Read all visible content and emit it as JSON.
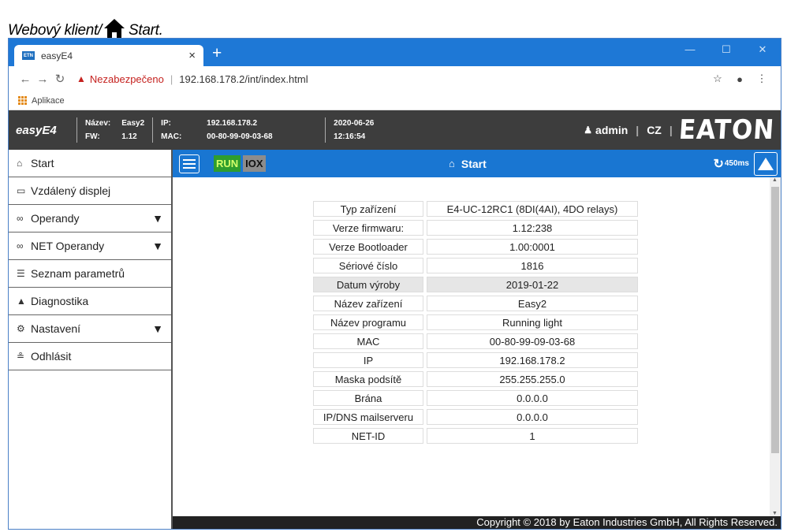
{
  "caption": {
    "prefix": "Webový klient/",
    "suffix": " Start."
  },
  "browser": {
    "tab_favicon": "ETN",
    "tab_title": "easyE4",
    "tab_close": "×",
    "new_tab": "+",
    "security_label": "Nezabezpečeno",
    "url": "192.168.178.2/int/index.html",
    "bookmarks_label": "Aplikace"
  },
  "header": {
    "brand": "easyE4",
    "name_label": "Název:",
    "name_value": "Easy2",
    "fw_label": "FW:",
    "fw_value": "1.12",
    "ip_label": "IP:",
    "ip_value": "192.168.178.2",
    "mac_label": "MAC:",
    "mac_value": "00-80-99-09-03-68",
    "date": "2020-06-26",
    "time": "12:16:54",
    "user": "admin",
    "lang": "CZ",
    "logo": "EATON"
  },
  "sidebar": {
    "items": [
      {
        "label": "Start",
        "icon": "home-icon",
        "glyph": "⌂",
        "caret": false
      },
      {
        "label": "Vzdálený displej",
        "icon": "monitor-icon",
        "glyph": "▭",
        "caret": false
      },
      {
        "label": "Operandy",
        "icon": "link-icon",
        "glyph": "∞",
        "caret": true
      },
      {
        "label": "NET Operandy",
        "icon": "link-icon",
        "glyph": "∞",
        "caret": true
      },
      {
        "label": "Seznam parametrů",
        "icon": "list-icon",
        "glyph": "☰",
        "caret": false
      },
      {
        "label": "Diagnostika",
        "icon": "warning-icon",
        "glyph": "▲",
        "caret": false
      },
      {
        "label": "Nastavení",
        "icon": "gear-icon",
        "glyph": "⚙",
        "caret": true
      },
      {
        "label": "Odhlásit",
        "icon": "user-icon",
        "glyph": "≗",
        "caret": false
      }
    ]
  },
  "toolbar": {
    "run": "RUN",
    "iox": "IOX",
    "title": "Start",
    "refresh": "450ms"
  },
  "table": {
    "rows": [
      {
        "key": "Typ zařízení",
        "value": "E4-UC-12RC1 (8DI(4AI), 4DO relays)"
      },
      {
        "key": "Verze firmwaru:",
        "value": "1.12:238"
      },
      {
        "key": "Verze Bootloader",
        "value": "1.00:0001"
      },
      {
        "key": "Sériové číslo",
        "value": "1816"
      },
      {
        "key": "Datum výroby",
        "value": "2019-01-22"
      },
      {
        "key": "Název zařízení",
        "value": "Easy2"
      },
      {
        "key": "Název programu",
        "value": "Running light"
      },
      {
        "key": "MAC",
        "value": "00-80-99-09-03-68"
      },
      {
        "key": "IP",
        "value": "192.168.178.2"
      },
      {
        "key": "Maska podsítě",
        "value": "255.255.255.0"
      },
      {
        "key": "Brána",
        "value": "0.0.0.0"
      },
      {
        "key": "IP/DNS mailserveru",
        "value": "0.0.0.0"
      },
      {
        "key": "NET-ID",
        "value": "1"
      }
    ]
  },
  "footer": "Copyright © 2018 by Eaton Industries GmbH, All Rights Reserved.",
  "colors": {
    "accent": "#1976d2",
    "titlebar": "#1e78d6",
    "header": "#3d3d3d",
    "run": "#2e9d2e"
  }
}
